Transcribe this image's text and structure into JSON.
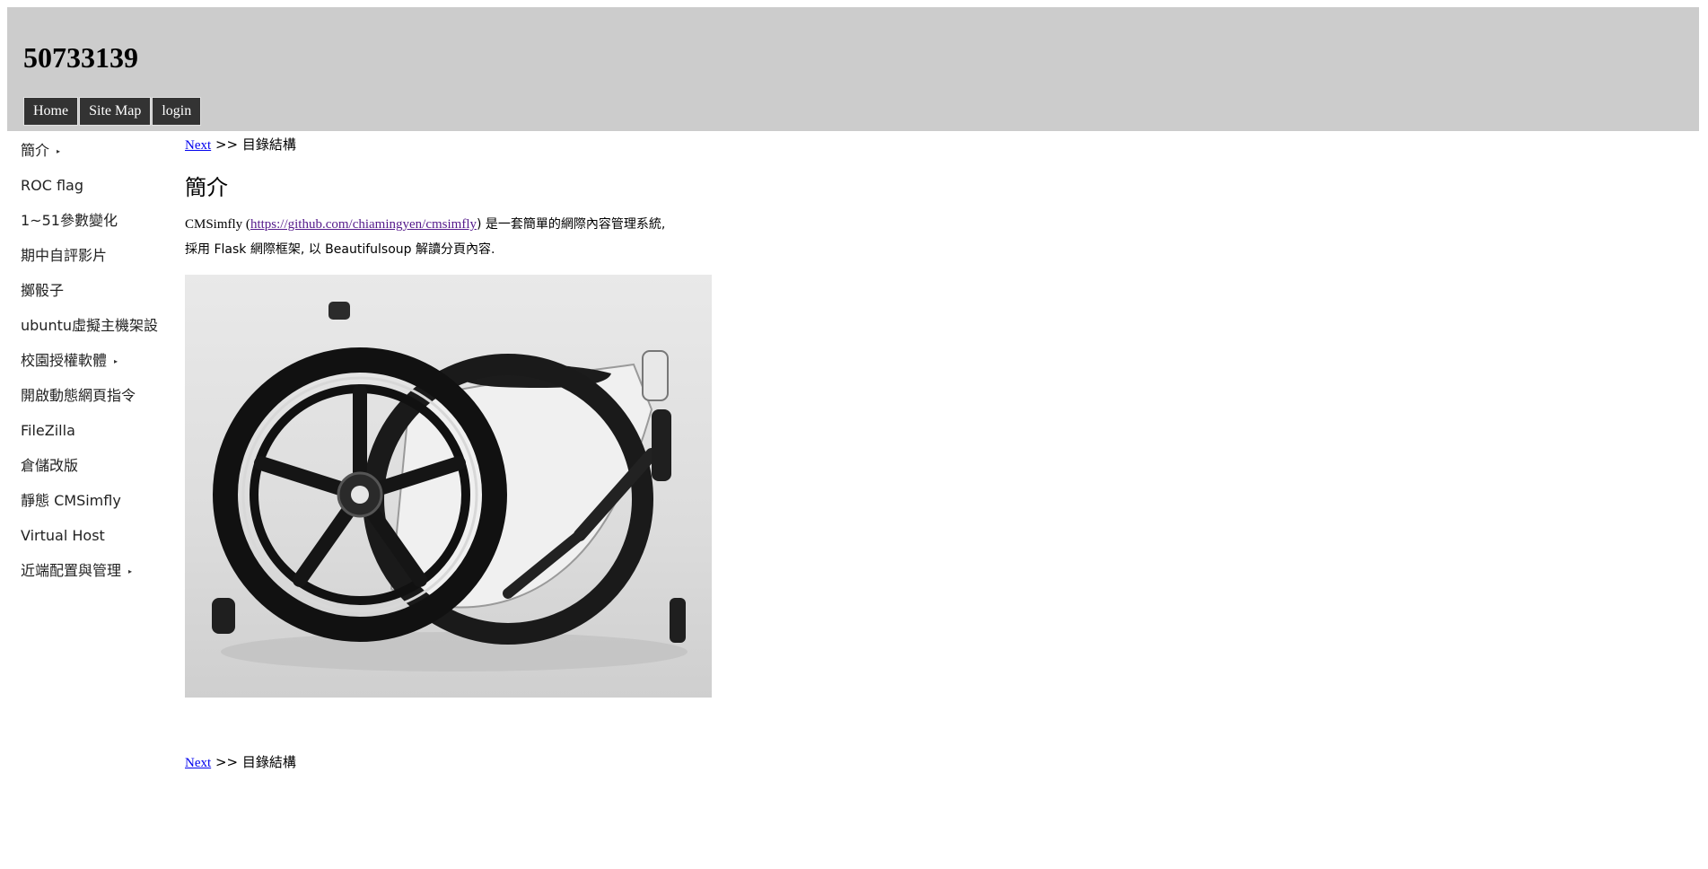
{
  "header": {
    "title": "50733139",
    "nav": [
      "Home",
      "Site Map",
      "login"
    ]
  },
  "sidebar": {
    "items": [
      {
        "label": "簡介",
        "has_submenu": true
      },
      {
        "label": "ROC flag",
        "has_submenu": false
      },
      {
        "label": "1~51參數變化",
        "has_submenu": false
      },
      {
        "label": "期中自評影片",
        "has_submenu": false
      },
      {
        "label": "擲骰子",
        "has_submenu": false
      },
      {
        "label": "ubuntu虛擬主機架設",
        "has_submenu": false
      },
      {
        "label": "校園授權軟體",
        "has_submenu": true
      },
      {
        "label": "開啟動態網頁指令",
        "has_submenu": false
      },
      {
        "label": "FileZilla",
        "has_submenu": false
      },
      {
        "label": "倉儲改版",
        "has_submenu": false
      },
      {
        "label": "靜態 CMSimfly",
        "has_submenu": false
      },
      {
        "label": "Virtual Host",
        "has_submenu": false
      },
      {
        "label": "近端配置與管理",
        "has_submenu": true
      }
    ]
  },
  "content": {
    "breadcrumb_next": "Next",
    "breadcrumb_sep": " >> ",
    "breadcrumb_current": "目錄結構",
    "heading": "簡介",
    "intro_prefix": "CMSimfly (",
    "intro_link": "https://github.com/chiamingyen/cmsimfly",
    "intro_suffix": ") 是一套簡單的網際內容管理系統,",
    "intro_line2": "採用 Flask 網際框架, 以 Beautifulsoup 解讀分頁內容."
  },
  "colors": {
    "header_bg": "#cccccc",
    "nav_bg": "#333333",
    "link": "#0000ee",
    "visited_link": "#551a8b"
  }
}
